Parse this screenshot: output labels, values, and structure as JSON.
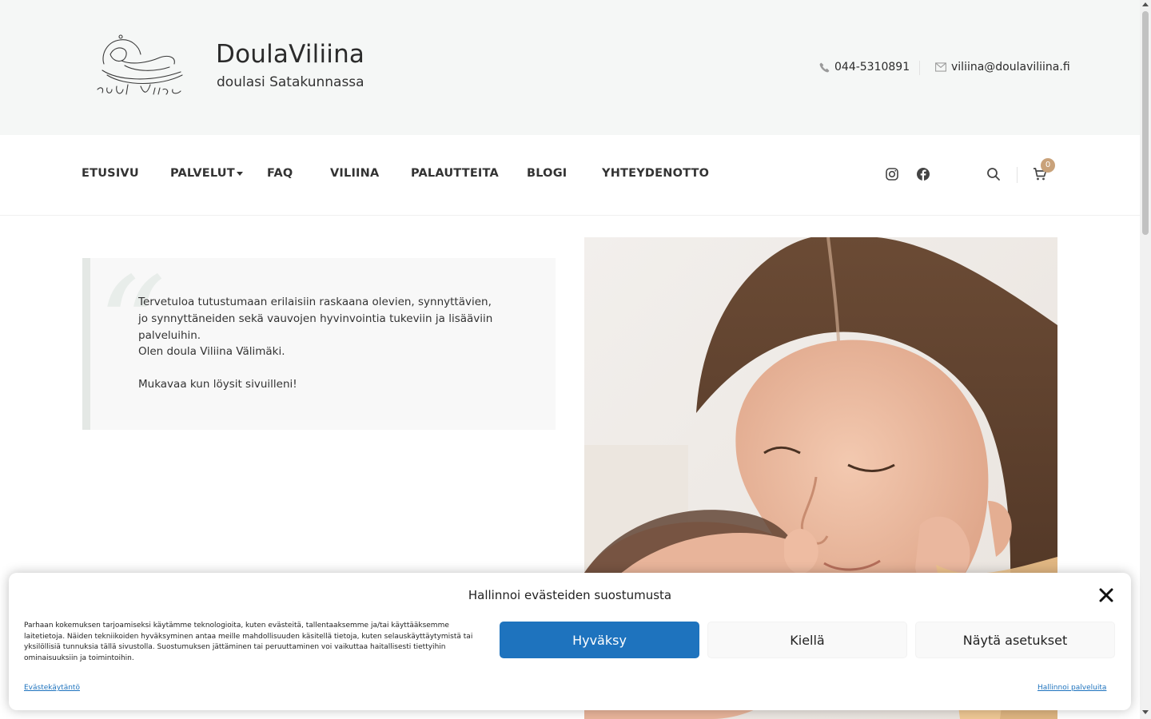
{
  "site": {
    "title": "DoulaViliina",
    "tagline": "doulasi Satakunnassa",
    "phone": "044-5310891",
    "email": "viliina@doulaviliina.fi"
  },
  "nav": {
    "items": [
      "ETUSIVU",
      "PALVELUT",
      "FAQ",
      "VILIINA",
      "PALAUTTEITA",
      "BLOGI",
      "YHTEYDENOTTO"
    ],
    "cart_count": "0"
  },
  "intro": {
    "paragraph_1": "Tervetuloa tutustumaan erilaisiin raskaana olevien, synnyttävien, jo synnyttäneiden sekä vauvojen hyvinvointia tukeviin ja lisääviin palveluihin.",
    "paragraph_2": "Olen doula Viliina Välimäki.",
    "paragraph_3": "Mukavaa kun löysit sivuilleni!"
  },
  "cookie": {
    "title": "Hallinnoi evästeiden suostumusta",
    "text": "Parhaan kokemuksen tarjoamiseksi käytämme teknologioita, kuten evästeitä, tallentaaksemme ja/tai käyttääksemme laitetietoja. Näiden tekniikoiden hyväksyminen antaa meille mahdollisuuden käsitellä tietoja, kuten selauskäyttäytymistä tai yksilöllisiä tunnuksia tällä sivustolla. Suostumuksen jättäminen tai peruuttaminen voi vaikuttaa haitallisesti tiettyihin ominaisuuksiin ja toimintoihin.",
    "accept": "Hyväksy",
    "deny": "Kiellä",
    "preferences": "Näytä asetukset",
    "policy_link": "Evästekäytäntö",
    "manage_link": "Hallinnoi palveluita"
  },
  "icons": {
    "phone": "phone-icon",
    "email": "envelope-icon",
    "instagram": "instagram-icon",
    "facebook": "facebook-icon",
    "search": "search-icon",
    "cart": "cart-icon",
    "close": "close-icon"
  },
  "colors": {
    "header_bg": "#f5f7f6",
    "accent_button": "#1e73be",
    "cart_badge": "#c9a27a",
    "quote_border": "#e4e8e5"
  }
}
